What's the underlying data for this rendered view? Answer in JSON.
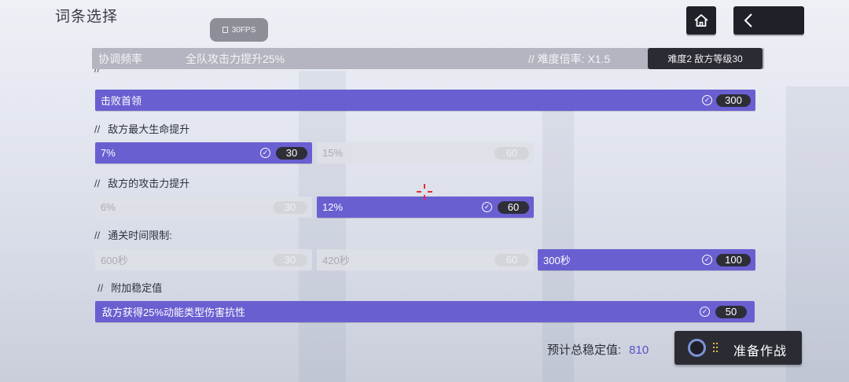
{
  "header": {
    "title": "词条选择",
    "fps_badge": "30FPS",
    "home_icon": "home-icon",
    "back_icon": "chevron-left-icon"
  },
  "info_bar": {
    "label": "协调频率",
    "bonus": "全队攻击力提升25%",
    "multiplier": "//  难度倍率:  X1.5",
    "difficulty_badge": "难度2  敌方等级30"
  },
  "sections": [
    {
      "title": "",
      "options": [
        {
          "label": "击败首领",
          "value": "300",
          "selected": true
        }
      ]
    },
    {
      "title": "敌方最大生命提升",
      "options": [
        {
          "label": "7%",
          "value": "30",
          "selected": true
        },
        {
          "label": "15%",
          "value": "60",
          "selected": false
        }
      ]
    },
    {
      "title": "敌方的攻击力提升",
      "options": [
        {
          "label": "6%",
          "value": "30",
          "selected": false
        },
        {
          "label": "12%",
          "value": "60",
          "selected": true
        }
      ]
    },
    {
      "title": "通关时间限制:",
      "options": [
        {
          "label": "600秒",
          "value": "30",
          "selected": false
        },
        {
          "label": "420秒",
          "value": "60",
          "selected": false
        },
        {
          "label": "300秒",
          "value": "100",
          "selected": true
        }
      ]
    },
    {
      "title": "附加稳定值",
      "options": [
        {
          "label": "敌方获得25%动能类型伤害抗性",
          "value": "50",
          "selected": true
        }
      ]
    }
  ],
  "footer": {
    "total_label": "预计总稳定值:",
    "total_value": "810",
    "ready_label": "准备作战"
  },
  "colors": {
    "selected": "#6a5fd1",
    "unselected": "#dee0e6",
    "dark_button": "#2a2b33",
    "crosshair": "#e0303a"
  }
}
